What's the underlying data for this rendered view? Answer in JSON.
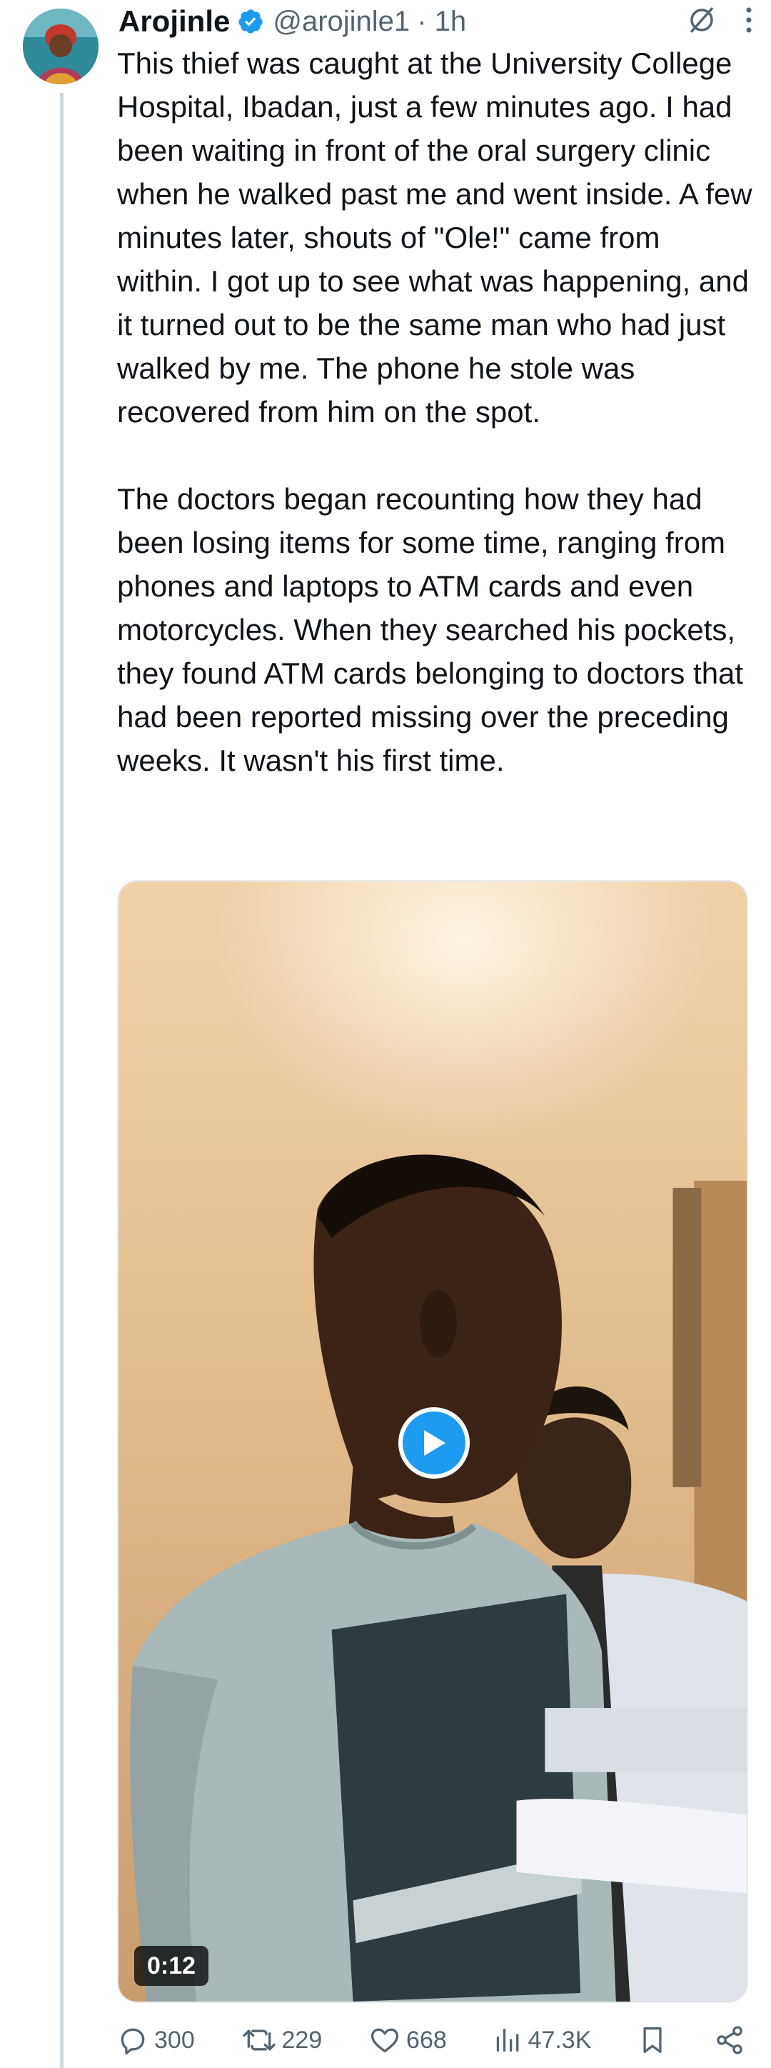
{
  "tweet": {
    "author": {
      "display_name": "Arojinle",
      "verified": true,
      "handle": "@arojinle1",
      "time": "· 1h",
      "avatar_icon": "avatar-photo"
    },
    "paragraphs": [
      "This thief was caught at the University College Hospital, Ibadan, just a few minutes ago. I had been waiting in front of the oral surgery clinic when he walked past me and went inside. A few minutes later, shouts of \"Ole!\" came from within. I got up to see what was happening, and it turned out to be the same man who had just walked by me. The phone he stole was recovered from him on the spot.",
      "The doctors began recounting how they had been losing items for some time, ranging from phones and laptops to ATM cards and even motorcycles. When they searched his pockets, they found ATM cards belonging to doctors that had been reported missing over the preceding weeks. It wasn't his first time."
    ],
    "media": {
      "type": "video",
      "duration": "0:12",
      "play_icon": "play-icon"
    },
    "actions": {
      "replies": "300",
      "reposts": "229",
      "likes": "668",
      "views": "47.3K"
    }
  },
  "colors": {
    "accent": "#1d9bf0",
    "text": "#0f1419",
    "secondary": "#536471",
    "thread_line": "#cfd9de"
  }
}
